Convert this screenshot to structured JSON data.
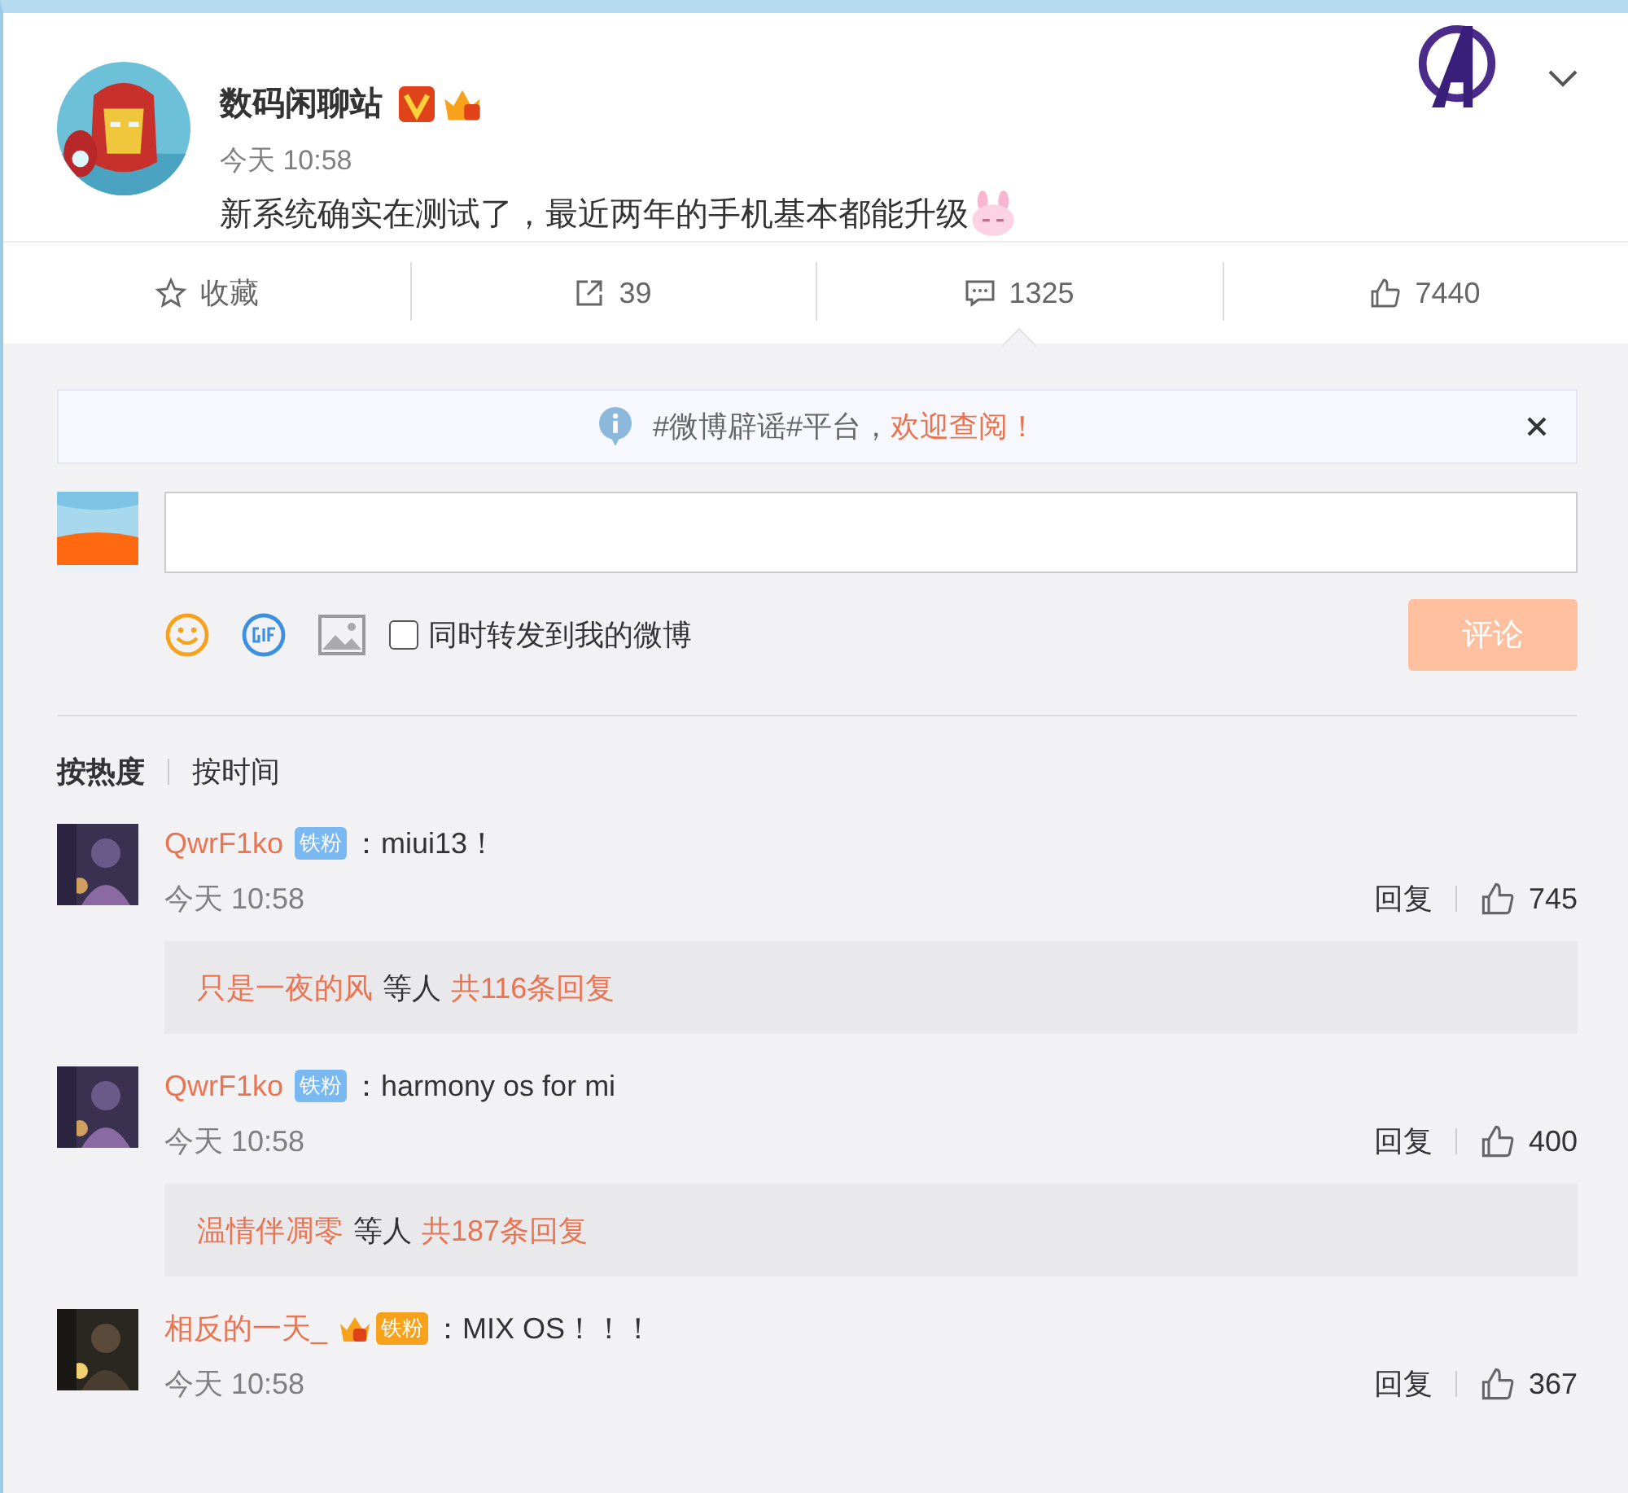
{
  "post": {
    "author": "数码闲聊站",
    "verified": true,
    "time": "今天 10:58",
    "text": "新系统确实在测试了，最近两年的手机基本都能升级"
  },
  "actions": [
    {
      "kind": "favorite",
      "label": "收藏",
      "selected": false
    },
    {
      "kind": "repost",
      "label": "39",
      "selected": false
    },
    {
      "kind": "comment",
      "label": "1325",
      "selected": true
    },
    {
      "kind": "like",
      "label": "7440",
      "selected": false
    }
  ],
  "notice": {
    "text": "#微博辟谣#平台，",
    "link": "欢迎查阅！"
  },
  "composer": {
    "repost_label": "同时转发到我的微博",
    "repost_checked": false,
    "submit": "评论",
    "submit_disabled": true
  },
  "sort_tabs": [
    {
      "label": "按热度",
      "selected": true
    },
    {
      "label": "按时间",
      "selected": false
    }
  ],
  "comments": [
    {
      "user": "QwrF1ko",
      "badge": "铁粉",
      "crown": false,
      "text": "：miui13！",
      "time": "今天 10:58",
      "reply": "回复",
      "likes": "745",
      "thread": {
        "users": "只是一夜的风",
        "suffix": "等人",
        "count": "共116条回复"
      }
    },
    {
      "user": "QwrF1ko",
      "badge": "铁粉",
      "crown": false,
      "text": "：harmony os for mi",
      "time": "今天 10:58",
      "reply": "回复",
      "likes": "400",
      "thread": {
        "users": "温情伴凋零",
        "suffix": "等人",
        "count": "共187条回复"
      }
    },
    {
      "user": "相反的一天_",
      "badge": "铁粉",
      "crown": true,
      "text": "：MIX OS！！！",
      "time": "今天 10:58",
      "reply": "回复",
      "likes": "367"
    }
  ]
}
